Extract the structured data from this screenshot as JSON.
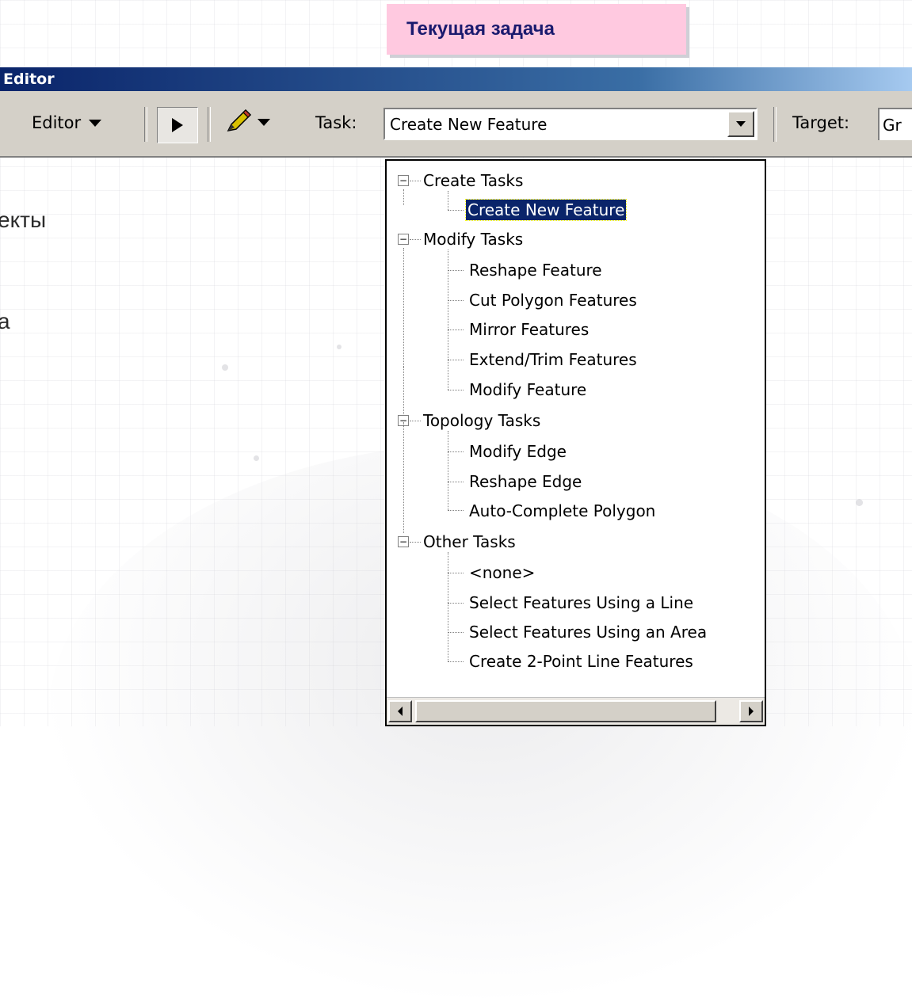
{
  "slide_title": "Текущая задача",
  "side_text": [
    "екты",
    "а"
  ],
  "editor": {
    "window_title": "Editor",
    "editor_menu_label": "Editor",
    "task_label": "Task:",
    "task_value": "Create New Feature",
    "target_label": "Target:",
    "target_value": "Gr"
  },
  "task_tree": [
    {
      "group": "Create Tasks",
      "items": [
        "Create New Feature"
      ],
      "selected": "Create New Feature"
    },
    {
      "group": "Modify Tasks",
      "items": [
        "Reshape Feature",
        "Cut Polygon Features",
        "Mirror Features",
        "Extend/Trim Features",
        "Modify Feature"
      ]
    },
    {
      "group": "Topology Tasks",
      "items": [
        "Modify Edge",
        "Reshape Edge",
        "Auto-Complete Polygon"
      ]
    },
    {
      "group": "Other Tasks",
      "items": [
        "<none>",
        "Select Features Using a Line",
        "Select Features Using an Area",
        "Create 2-Point Line Features"
      ]
    }
  ],
  "colors": {
    "title_bg": "#ffc9e0",
    "selection": "#0a246a",
    "titlebar": "#0a246a"
  }
}
